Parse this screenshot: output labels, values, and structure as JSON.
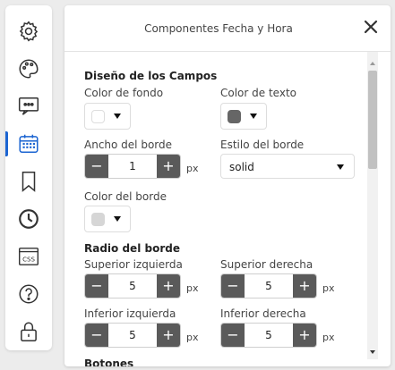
{
  "sidebar": {
    "items": [
      {
        "icon": "gear-icon"
      },
      {
        "icon": "palette-icon"
      },
      {
        "icon": "chat-bubble-icon"
      },
      {
        "icon": "calendar-icon",
        "active": true
      },
      {
        "icon": "bookmark-icon"
      },
      {
        "icon": "clock-icon"
      },
      {
        "icon": "css-file-icon",
        "text": "CSS"
      },
      {
        "icon": "help-icon"
      },
      {
        "icon": "lock-icon"
      }
    ],
    "accent": "#1b64d1"
  },
  "panel": {
    "title": "Componentes Fecha y Hora",
    "close_icon": "close-icon"
  },
  "design": {
    "title": "Diseño de los Campos",
    "bg_color_label": "Color de fondo",
    "bg_color_value": "#ffffff",
    "text_color_label": "Color de texto",
    "text_color_value": "#666666",
    "border_width_label": "Ancho del borde",
    "border_width_value": "1",
    "border_width_unit": "px",
    "border_style_label": "Estilo del borde",
    "border_style_value": "solid",
    "border_color_label": "Color del borde",
    "border_color_value": "#d6d6d6"
  },
  "radius": {
    "title": "Radio del borde",
    "top_left_label": "Superior izquierda",
    "top_left_value": "5",
    "top_right_label": "Superior derecha",
    "top_right_value": "5",
    "bottom_left_label": "Inferior izquierda",
    "bottom_left_value": "5",
    "bottom_right_label": "Inferior derecha",
    "bottom_right_value": "5",
    "unit": "px"
  },
  "stepper": {
    "minus": "−",
    "plus": "+"
  },
  "next_section_partial": "Botones"
}
